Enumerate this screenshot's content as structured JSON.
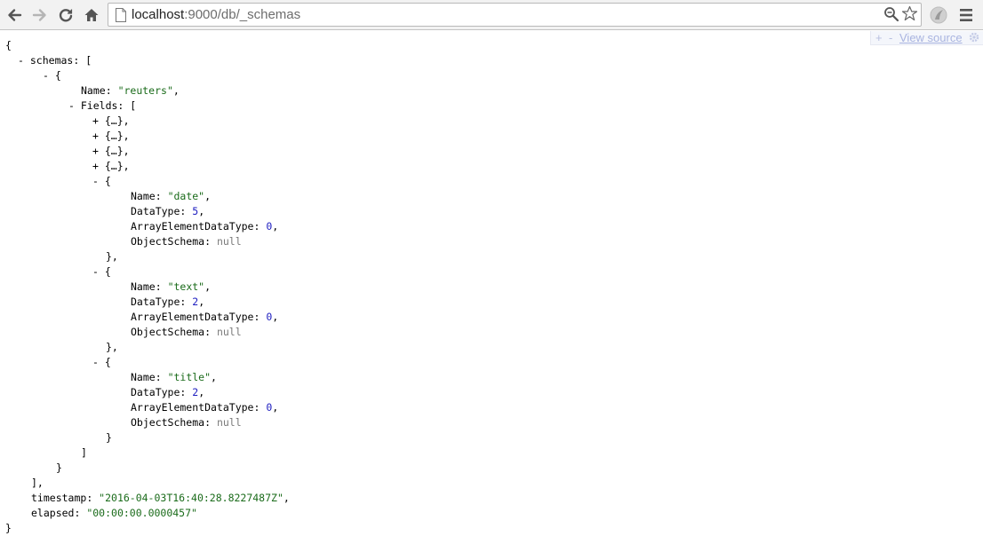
{
  "browser": {
    "url_host": "localhost",
    "url_path": ":9000/db/_schemas",
    "icons": {
      "back": "back-arrow-icon",
      "forward": "forward-arrow-icon",
      "reload": "reload-icon",
      "home": "home-icon",
      "page": "page-icon",
      "zoom": "zoom-icon",
      "star": "bookmark-star-icon",
      "extension": "extension-icon",
      "menu": "hamburger-menu-icon"
    }
  },
  "viewer": {
    "expand": "+",
    "collapse": "-",
    "view_source": "View source",
    "settings_icon": "gear-icon"
  },
  "json": {
    "open_brace": "{",
    "close_brace": "}",
    "toggle_collapse": "-",
    "toggle_expand": "+",
    "schemas_key": "schemas",
    "schemas_open": "[",
    "schemas_close": "],",
    "schema": {
      "open": "{",
      "close": "}",
      "name_key": "Name",
      "name_value": "\"reuters\"",
      "fields_key": "Fields",
      "fields_open": "[",
      "fields_close": "]",
      "collapsed_fields": [
        "{…},",
        "{…},",
        "{…},",
        "{…},"
      ],
      "fields": [
        {
          "open": "{",
          "close": "},",
          "name_key": "Name",
          "name_value": "\"date\"",
          "datatype_key": "DataType",
          "datatype_value": "5",
          "array_key": "ArrayElementDataType",
          "array_value": "0",
          "object_key": "ObjectSchema",
          "object_value": "null"
        },
        {
          "open": "{",
          "close": "},",
          "name_key": "Name",
          "name_value": "\"text\"",
          "datatype_key": "DataType",
          "datatype_value": "2",
          "array_key": "ArrayElementDataType",
          "array_value": "0",
          "object_key": "ObjectSchema",
          "object_value": "null"
        },
        {
          "open": "{",
          "close": "}",
          "name_key": "Name",
          "name_value": "\"title\"",
          "datatype_key": "DataType",
          "datatype_value": "2",
          "array_key": "ArrayElementDataType",
          "array_value": "0",
          "object_key": "ObjectSchema",
          "object_value": "null"
        }
      ]
    },
    "timestamp_key": "timestamp",
    "timestamp_value": "\"2016-04-03T16:40:28.8227487Z\"",
    "elapsed_key": "elapsed",
    "elapsed_value": "\"00:00:00.0000457\""
  },
  "colors": {
    "string": "#1a6b1a",
    "number": "#1d1dc0",
    "null": "#7a7a7a",
    "toolbar_bg": "#f2f2f2",
    "view_source_link": "#a9b4e0"
  }
}
